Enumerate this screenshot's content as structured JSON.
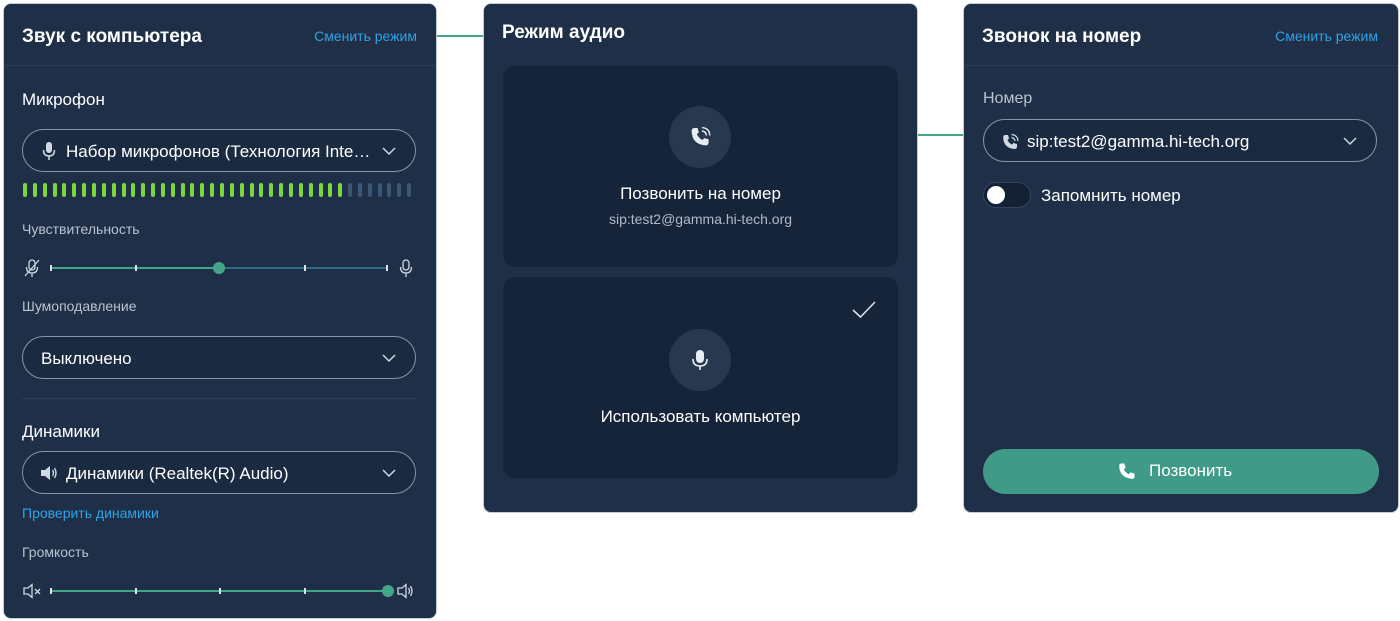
{
  "computer_audio": {
    "title": "Звук с компьютера",
    "change_mode_link": "Сменить режим",
    "microphone": {
      "section_label": "Микрофон",
      "selected_device": "Набор микрофонов (Технология Intel® Smart Sound для цифровых микрофонов)",
      "level_meter": {
        "segments": 40,
        "active": 33,
        "active_color": "#7bd63e",
        "inactive_color": "#3b5775"
      }
    },
    "sensitivity": {
      "label": "Чувствительность",
      "value_fraction": 0.5
    },
    "noise_suppression": {
      "label": "Шумоподавление",
      "value": "Выключено"
    },
    "speakers": {
      "section_label": "Динамики",
      "selected_device": "Динамики (Realtek(R) Audio)",
      "test_link": "Проверить динамики"
    },
    "volume": {
      "label": "Громкость",
      "value_fraction": 1.0
    }
  },
  "audio_mode": {
    "title": "Режим аудио",
    "options": [
      {
        "label": "Позвонить на номер",
        "sublabel": "sip:test2@gamma.hi-tech.org",
        "icon": "phone-call-icon",
        "selected": false
      },
      {
        "label": "Использовать компьютер",
        "icon": "microphone-icon",
        "selected": true
      }
    ]
  },
  "phone_call": {
    "title": "Звонок на номер",
    "change_mode_link": "Сменить режим",
    "number_label": "Номер",
    "number_value": "sip:test2@gamma.hi-tech.org",
    "remember_label": "Запомнить номер",
    "remember_enabled": false,
    "call_button": "Позвонить"
  },
  "colors": {
    "panel_bg": "#1e2f47",
    "card_bg": "#16243a",
    "accent_green": "#43a58a",
    "link_blue": "#2fa3e6"
  }
}
